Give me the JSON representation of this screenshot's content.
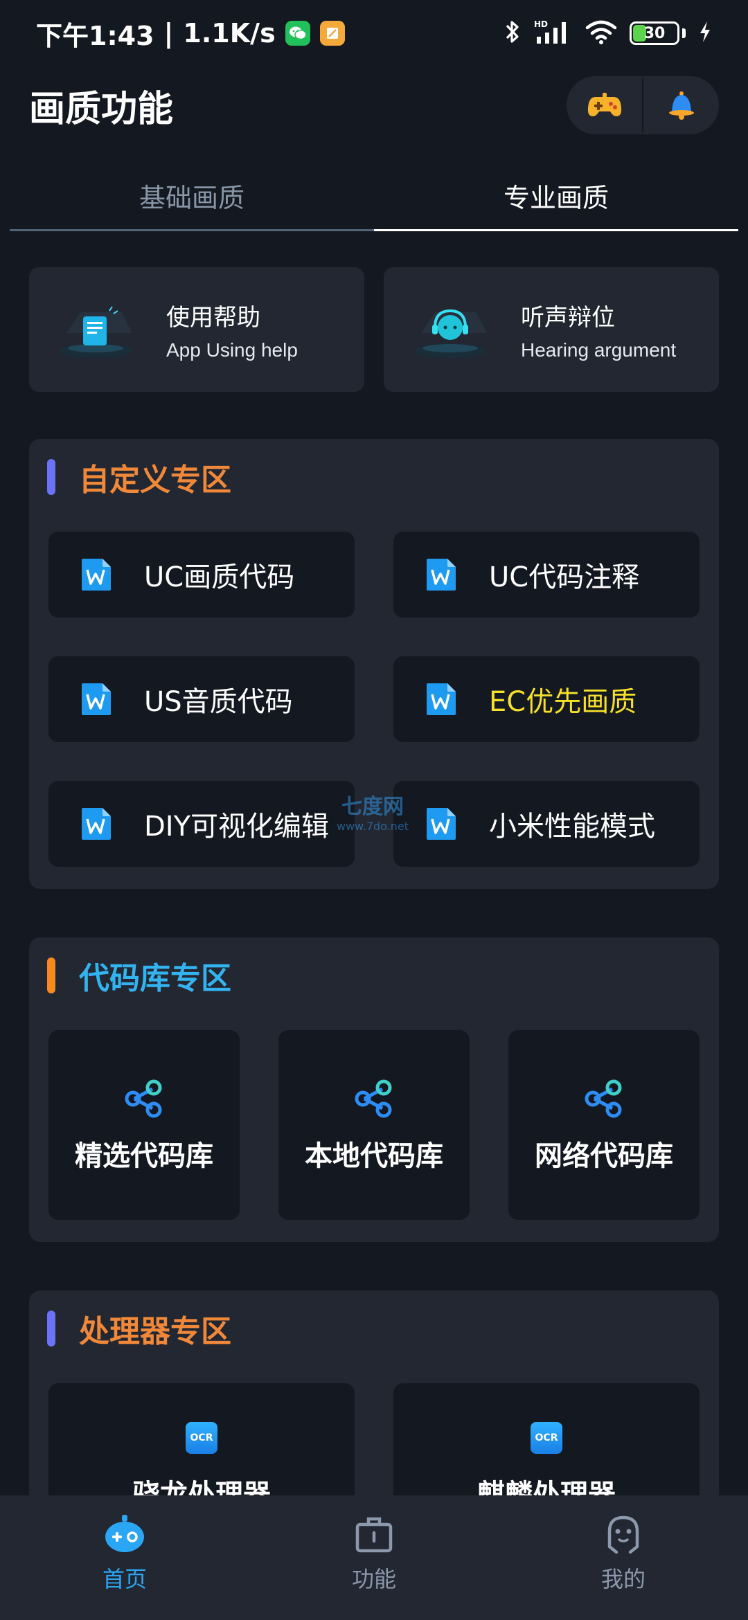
{
  "status_bar": {
    "time": "下午1:43",
    "separator": "|",
    "net_speed": "1.1K/s",
    "battery_level": "30",
    "battery_fraction": 0.3,
    "icons": [
      "wechat-icon",
      "notes-icon",
      "bluetooth-icon",
      "hd-signal-icon",
      "wifi-icon",
      "battery-icon",
      "charging-icon"
    ]
  },
  "header": {
    "title": "画质功能",
    "actions": [
      "gamepad-icon",
      "bell-icon"
    ]
  },
  "tabs": [
    {
      "label": "基础画质",
      "active": false
    },
    {
      "label": "专业画质",
      "active": true
    }
  ],
  "help_cards": [
    {
      "title": "使用帮助",
      "subtitle": "App Using help"
    },
    {
      "title": "听声辩位",
      "subtitle": "Hearing argument"
    }
  ],
  "custom_section": {
    "title": "自定义专区",
    "title_color": "#f0883a",
    "bar_color": "#6b72f5",
    "items": [
      {
        "label": "UC画质代码",
        "color": "#ffffff"
      },
      {
        "label": "UC代码注释",
        "color": "#ffffff"
      },
      {
        "label": "US音质代码",
        "color": "#ffffff"
      },
      {
        "label": "EC优先画质",
        "color": "#f5e02a"
      },
      {
        "label": "DIY可视化编辑",
        "color": "#ffffff"
      },
      {
        "label": "小米性能模式",
        "color": "#ffffff"
      }
    ]
  },
  "watermark": {
    "main": "七度网",
    "sub": "www.7do.net"
  },
  "library_section": {
    "title": "代码库专区",
    "title_color": "#33b3f0",
    "bar_color": "#f58a1f",
    "items": [
      {
        "label": "精选代码库"
      },
      {
        "label": "本地代码库"
      },
      {
        "label": "网络代码库"
      }
    ]
  },
  "processor_section": {
    "title": "处理器专区",
    "title_color": "#f0883a",
    "bar_color": "#6b72f5",
    "items": [
      {
        "label": "骁龙处理器",
        "icon_text": "OCR"
      },
      {
        "label": "麒麟处理器",
        "icon_text": "OCR"
      }
    ]
  },
  "bottom_nav": [
    {
      "label": "首页",
      "active": true
    },
    {
      "label": "功能",
      "active": false
    },
    {
      "label": "我的",
      "active": false
    }
  ],
  "colors": {
    "background": "#141820",
    "card": "#222731",
    "accent": "#2aa6f5"
  }
}
